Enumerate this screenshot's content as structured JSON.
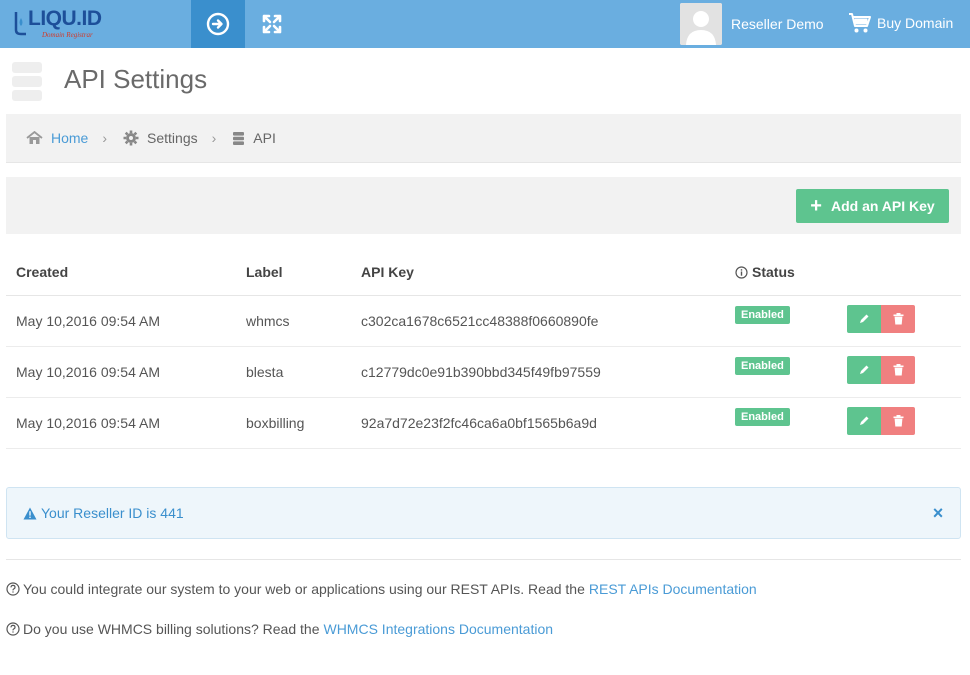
{
  "brand": {
    "name": "LIQU.ID",
    "tagline": "Domain Registrar"
  },
  "topbar": {
    "nav_icon": "arrow-circle-right-icon",
    "fullscreen_icon": "expand-icon",
    "user_name": "Reseller Demo",
    "cart_label": "Buy Domain"
  },
  "page": {
    "title": "API Settings"
  },
  "breadcrumb": {
    "items": [
      {
        "label": "Home",
        "icon": "home-icon"
      },
      {
        "label": "Settings",
        "icon": "gear-icon"
      },
      {
        "label": "API",
        "icon": "server-icon"
      }
    ],
    "separator": "›"
  },
  "toolbar": {
    "add_label": "Add an API Key"
  },
  "table": {
    "headers": {
      "created": "Created",
      "label": "Label",
      "key": "API Key",
      "status": "Status"
    },
    "rows": [
      {
        "created": "May 10,2016 09:54 AM",
        "label": "whmcs",
        "key": "c302ca1678c6521cc48388f0660890fe",
        "status": "Enabled"
      },
      {
        "created": "May 10,2016 09:54 AM",
        "label": "blesta",
        "key": "c12779dc0e91b390bbd345f49fb97559",
        "status": "Enabled"
      },
      {
        "created": "May 10,2016 09:54 AM",
        "label": "boxbilling",
        "key": "92a7d72e23f2fc46ca6a0bf1565b6a9d",
        "status": "Enabled"
      }
    ]
  },
  "alert": {
    "text": "Your Reseller ID is 441",
    "close": "×"
  },
  "info": {
    "line1_text": "You could integrate our system to your web or applications using our REST APIs. Read the",
    "line1_link": "REST APIs Documentation",
    "line2_text": "Do you use WHMCS billing solutions? Read the",
    "line2_link": "WHMCS Integrations Documentation"
  },
  "colors": {
    "topbar": "#6aaee0",
    "active": "#3a8fcd",
    "green": "#5ec48f",
    "red": "#f08080",
    "link": "#4a9bd6"
  }
}
